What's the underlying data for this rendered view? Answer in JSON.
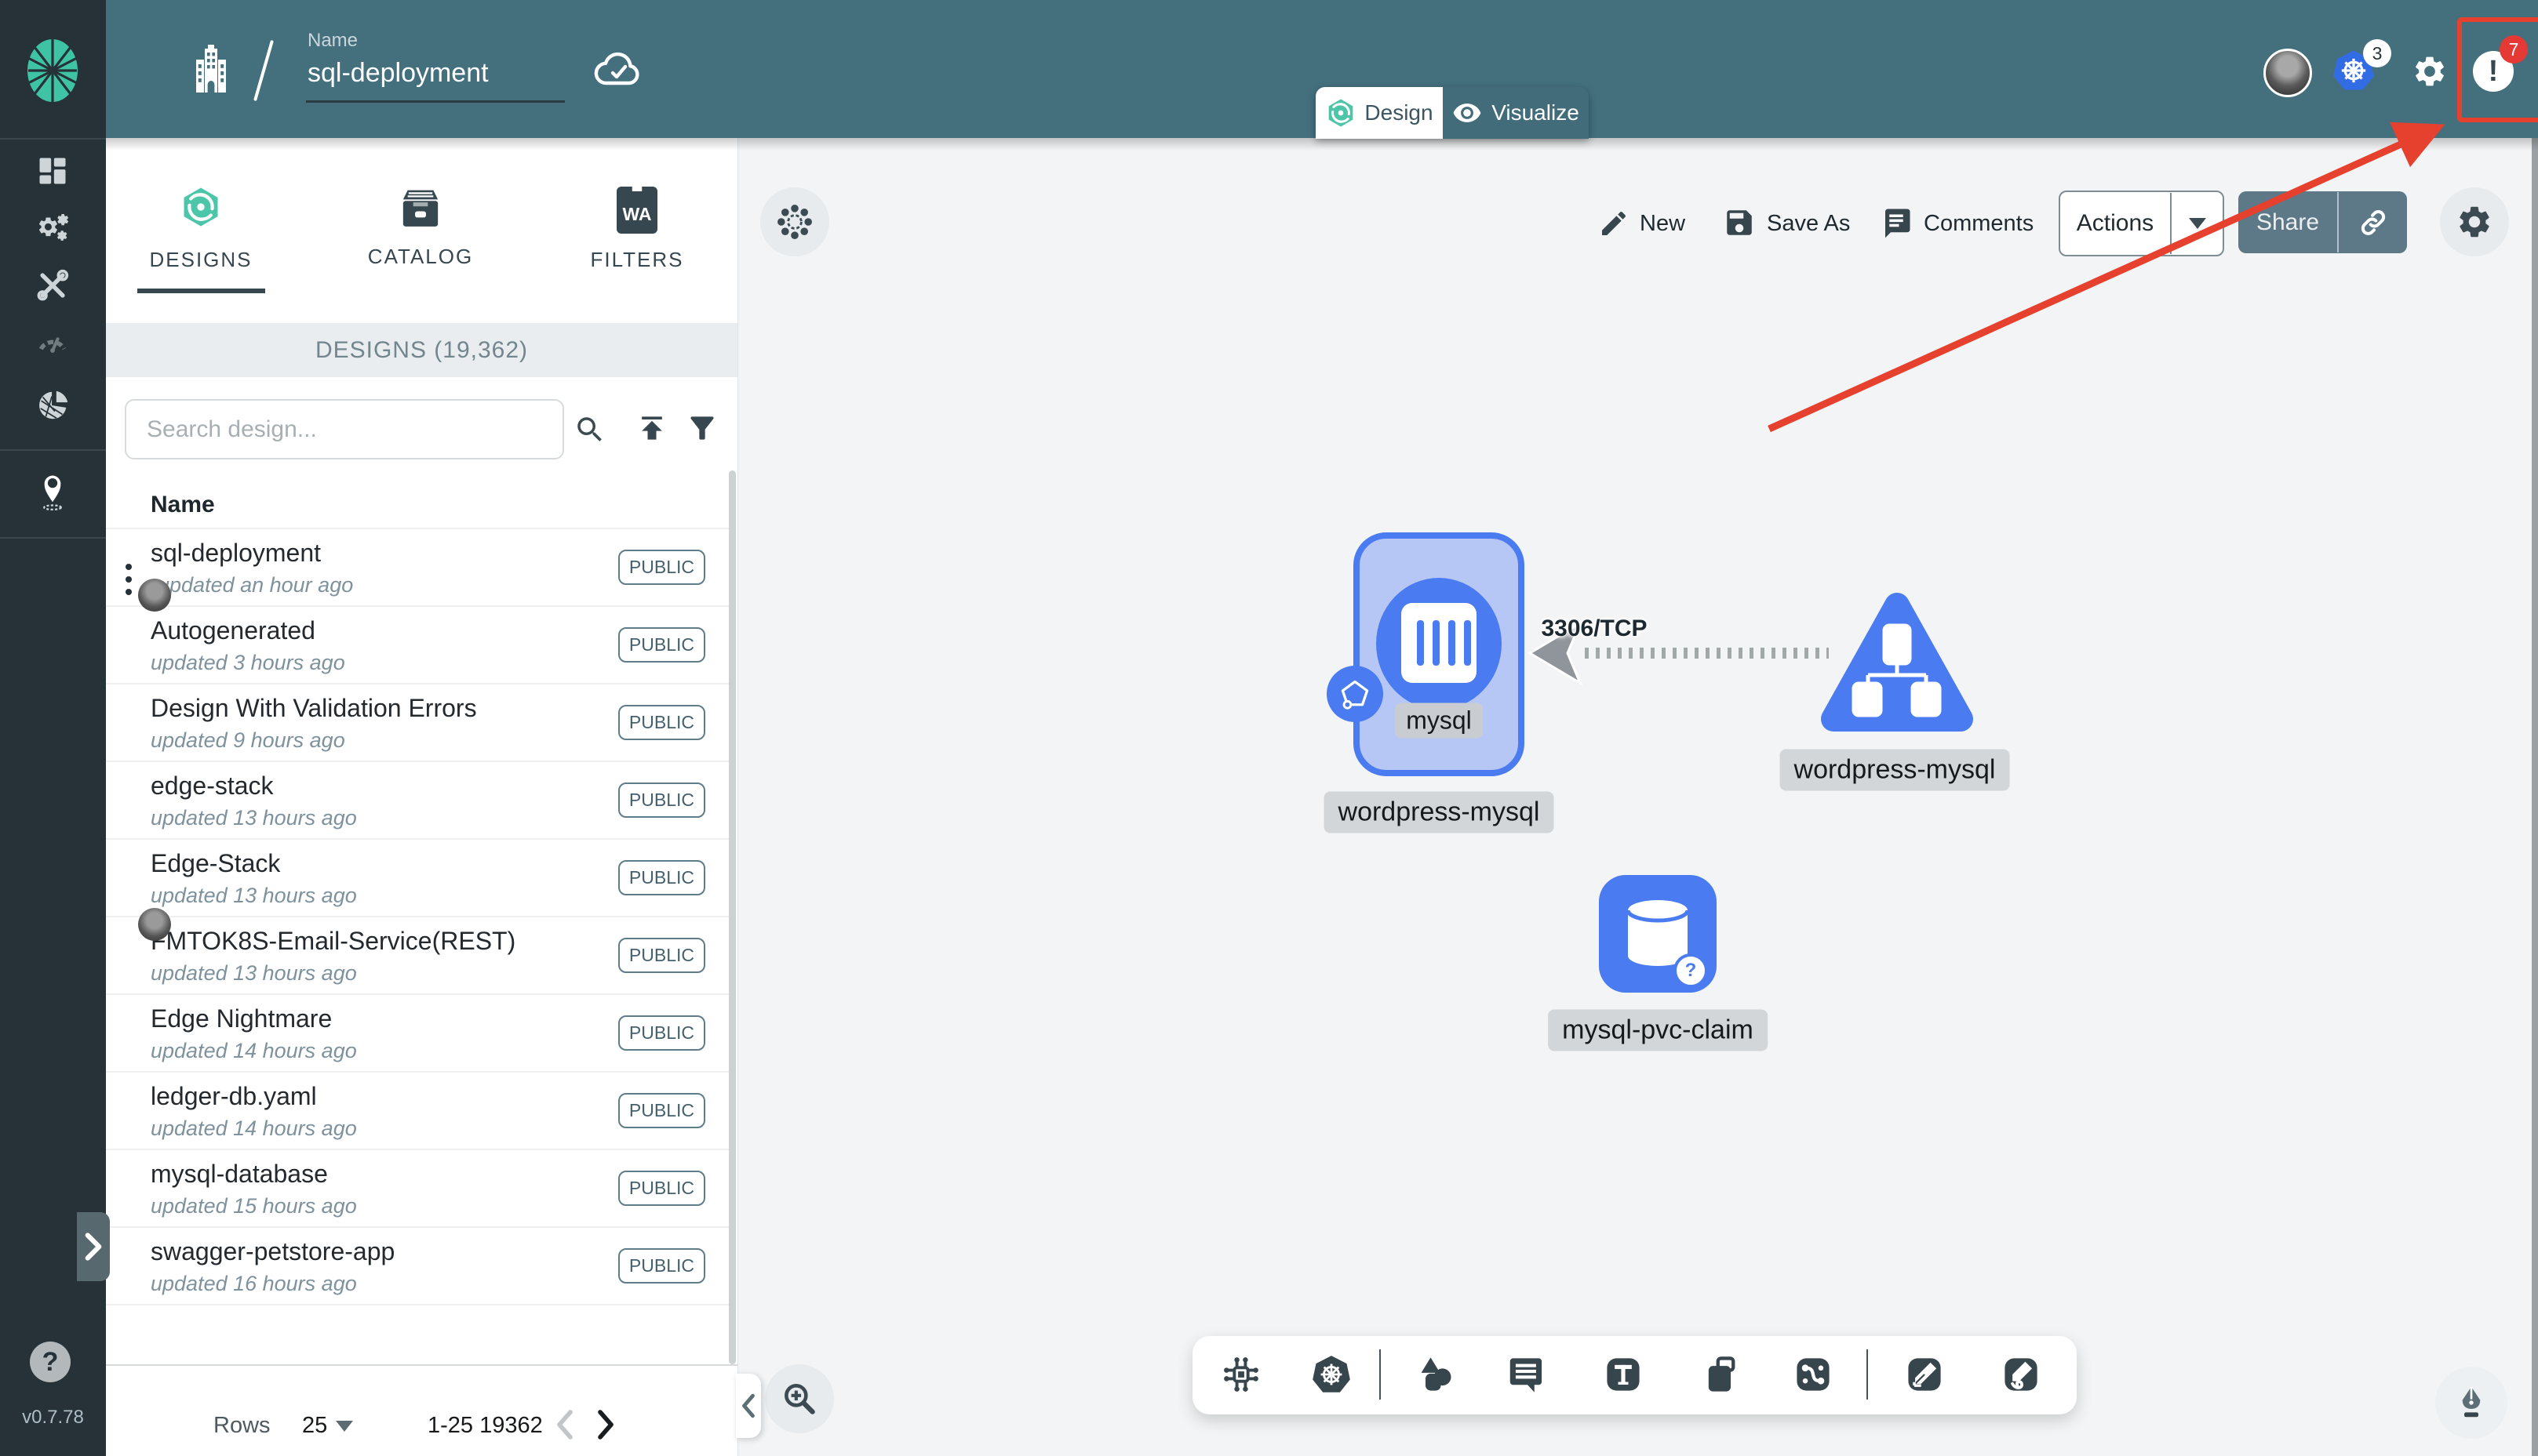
{
  "colors": {
    "header_teal": "#44707E",
    "sidebar_dark": "#263238",
    "accent_green": "#00B39F",
    "node_blue": "#4A7BF0",
    "annotation_red": "#E6402E",
    "share_slate": "#5D7887"
  },
  "header": {
    "name_label": "Name",
    "design_name": "sql-deployment",
    "design_tab": "Design",
    "visualize_tab": "Visualize",
    "k8s_context_count": "3",
    "notification_count": "7",
    "notification_glyph": "!"
  },
  "sidebar": {
    "help_glyph": "?",
    "version": "v0.7.78"
  },
  "panel": {
    "tab_designs": "DESIGNS",
    "tab_catalog": "CATALOG",
    "tab_filters": "FILTERS",
    "filters_icon_text": "WA",
    "count_header": "DESIGNS (19,362)",
    "search_placeholder": "Search design...",
    "column_name": "Name",
    "rows": [
      {
        "name": "sql-deployment",
        "updated": "updated an hour ago",
        "badge": "PUBLIC"
      },
      {
        "name": "Autogenerated",
        "updated": "updated 3 hours ago",
        "badge": "PUBLIC"
      },
      {
        "name": "Design With Validation Errors",
        "updated": "updated 9 hours ago",
        "badge": "PUBLIC"
      },
      {
        "name": "edge-stack",
        "updated": "updated 13 hours ago",
        "badge": "PUBLIC"
      },
      {
        "name": "Edge-Stack",
        "updated": "updated 13 hours ago",
        "badge": "PUBLIC"
      },
      {
        "name": "FMTOK8S-Email-Service(REST)",
        "updated": "updated 13 hours ago",
        "badge": "PUBLIC"
      },
      {
        "name": "Edge Nightmare",
        "updated": "updated 14 hours ago",
        "badge": "PUBLIC"
      },
      {
        "name": "ledger-db.yaml",
        "updated": "updated 14 hours ago",
        "badge": "PUBLIC"
      },
      {
        "name": "mysql-database",
        "updated": "updated 15 hours ago",
        "badge": "PUBLIC"
      },
      {
        "name": "swagger-petstore-app",
        "updated": "updated 16 hours ago",
        "badge": "PUBLIC"
      }
    ],
    "pagination": {
      "rows_label": "Rows",
      "per_page": "25",
      "range": "1-25 19362"
    }
  },
  "canvas": {
    "actions": {
      "new": "New",
      "save_as": "Save As",
      "comments": "Comments",
      "actions": "Actions",
      "share": "Share"
    },
    "nodes": {
      "container_label": "mysql",
      "deployment_label": "wordpress-mysql",
      "service_label": "wordpress-mysql",
      "pvc_label": "mysql-pvc-claim",
      "pvc_question": "?"
    },
    "edge": {
      "label": "3306/TCP"
    }
  }
}
